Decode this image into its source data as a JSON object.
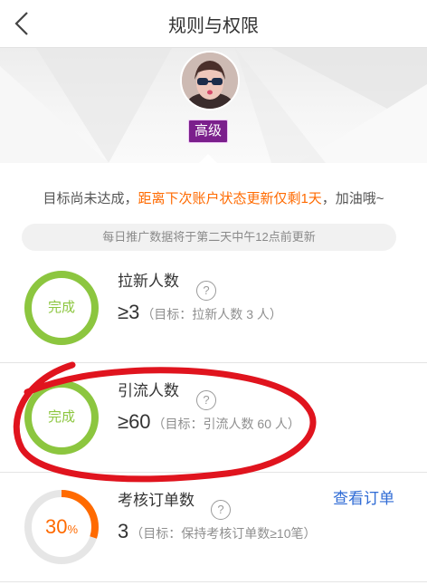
{
  "header": {
    "title": "规则与权限",
    "back_icon": "chevron-left-icon"
  },
  "profile": {
    "level_badge": "高级",
    "badge_color": "#7b1f8c"
  },
  "notice": {
    "prefix": "目标尚未达成，",
    "highlight": "距离下次账户状态更新仅剩1天",
    "suffix": "，加油哦~",
    "highlight_color": "#ff6a00"
  },
  "update_note": "每日推广数据将于第二天中午12点前更新",
  "metrics": [
    {
      "title": "拉新人数",
      "status": "完成",
      "progress": 1.0,
      "value": "≥3",
      "target": "（目标：拉新人数 3 人）"
    },
    {
      "title": "引流人数",
      "status": "完成",
      "progress": 1.0,
      "value": "≥60",
      "target": "（目标：引流人数 60 人）"
    },
    {
      "title": "考核订单数",
      "status_value": "30",
      "status_unit": "%",
      "progress": 0.3,
      "value": "3",
      "target": "（目标：保持考核订单数≥10笔）",
      "action": "查看订单"
    }
  ],
  "help_glyph": "?",
  "colors": {
    "complete": "#8cc63f",
    "partial": "#ff6a00",
    "link": "#2f6bd5",
    "annotation": "#e0141e"
  }
}
